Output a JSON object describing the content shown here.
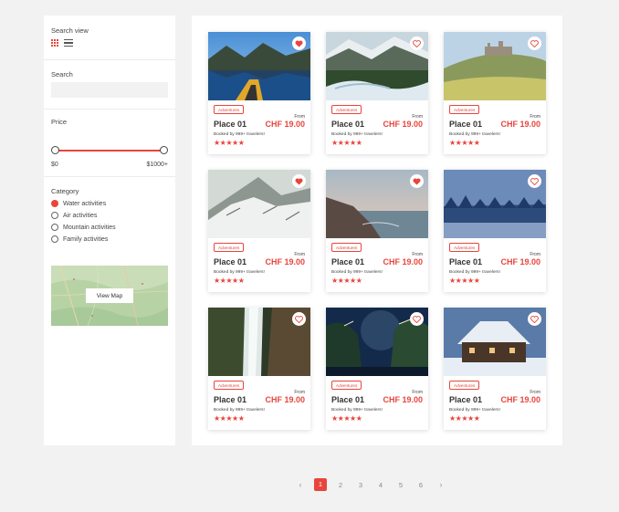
{
  "sidebar": {
    "search_view_label": "Search view",
    "search_label": "Search",
    "search_placeholder": "",
    "price_label": "Price",
    "price_min": "$0",
    "price_max": "$1000+",
    "category_label": "Category",
    "categories": [
      {
        "label": "Water activities",
        "checked": true
      },
      {
        "label": "Air activities",
        "checked": false
      },
      {
        "label": "Mountain activities",
        "checked": false
      },
      {
        "label": "Family activities",
        "checked": false
      }
    ],
    "map_button": "View Map"
  },
  "cards": [
    {
      "badge": "Adventures",
      "from": "From",
      "title": "Place 01",
      "price": "CHF 19.00",
      "booked": "Booked by 999+ travelers!",
      "stars": "★★★★★",
      "favorited": true
    },
    {
      "badge": "Adventures",
      "from": "From",
      "title": "Place 01",
      "price": "CHF 19.00",
      "booked": "Booked by 999+ travelers!",
      "stars": "★★★★★",
      "favorited": false
    },
    {
      "badge": "Adventures",
      "from": "From",
      "title": "Place 01",
      "price": "CHF 19.00",
      "booked": "Booked by 999+ travelers!",
      "stars": "★★★★★",
      "favorited": false
    },
    {
      "badge": "Adventures",
      "from": "From",
      "title": "Place 01",
      "price": "CHF 19.00",
      "booked": "Booked by 999+ travelers!",
      "stars": "★★★★★",
      "favorited": true
    },
    {
      "badge": "Adventures",
      "from": "From",
      "title": "Place 01",
      "price": "CHF 19.00",
      "booked": "Booked by 999+ travelers!",
      "stars": "★★★★★",
      "favorited": true
    },
    {
      "badge": "Adventures",
      "from": "From",
      "title": "Place 01",
      "price": "CHF 19.00",
      "booked": "Booked by 999+ travelers!",
      "stars": "★★★★★",
      "favorited": false
    },
    {
      "badge": "Adventures",
      "from": "From",
      "title": "Place 01",
      "price": "CHF 19.00",
      "booked": "Booked by 999+ travelers!",
      "stars": "★★★★★",
      "favorited": false
    },
    {
      "badge": "Adventures",
      "from": "From",
      "title": "Place 01",
      "price": "CHF 19.00",
      "booked": "Booked by 999+ travelers!",
      "stars": "★★★★★",
      "favorited": false
    },
    {
      "badge": "Adventures",
      "from": "From",
      "title": "Place 01",
      "price": "CHF 19.00",
      "booked": "Booked by 999+ travelers!",
      "stars": "★★★★★",
      "favorited": false
    }
  ],
  "pagination": {
    "prev": "‹",
    "pages": [
      "1",
      "2",
      "3",
      "4",
      "5",
      "6"
    ],
    "current": "1",
    "next": "›"
  },
  "colors": {
    "accent": "#e8453c",
    "background": "#f2f2f2"
  }
}
